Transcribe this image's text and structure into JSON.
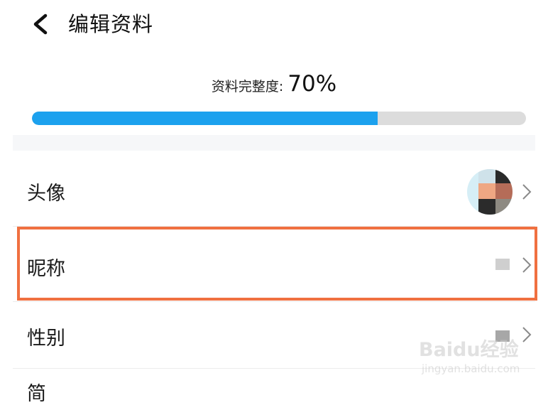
{
  "header": {
    "title": "编辑资料",
    "back_icon": "chevron-left-icon"
  },
  "completeness": {
    "label": "资料完整度:",
    "value": "70%",
    "progress_fraction": 0.7,
    "fill_color": "#1ca1ee"
  },
  "rows": [
    {
      "label": "头像",
      "value_type": "avatar-image"
    },
    {
      "label": "昵称",
      "value_type": "blurred-text"
    },
    {
      "label": "性别",
      "value_type": "blurred-text"
    }
  ],
  "partial_row_label": "简",
  "highlight": {
    "color": "#f07040",
    "target": "昵称"
  },
  "watermark": {
    "brand": "Baidu经验",
    "url": "jingyan.baidu.com"
  }
}
